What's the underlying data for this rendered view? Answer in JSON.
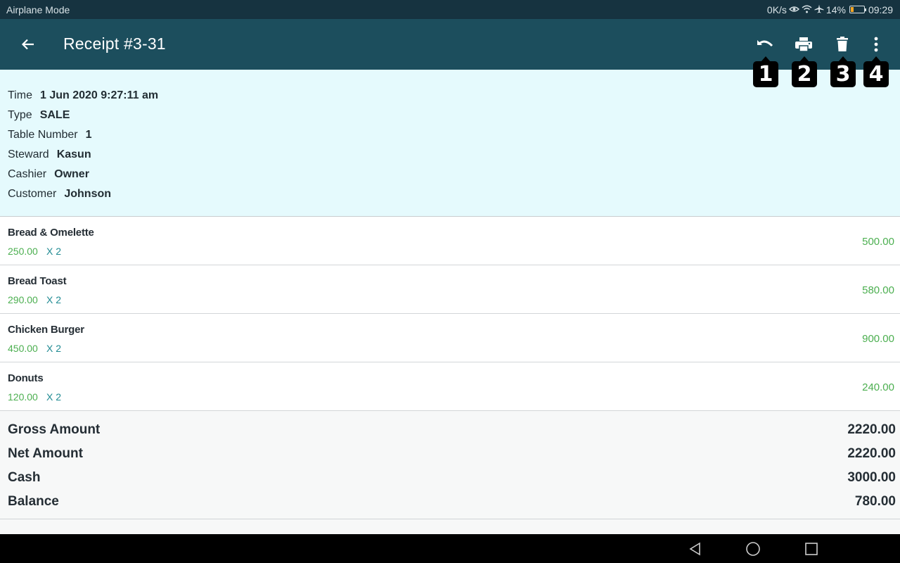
{
  "status_bar": {
    "left_text": "Airplane Mode",
    "net_speed": "0K/s",
    "icons": [
      "eye-comfort-icon",
      "wifi-icon",
      "airplane-icon"
    ],
    "battery_percent": "14%",
    "time": "09:29"
  },
  "app_bar": {
    "title": "Receipt #3-31",
    "back_icon": "arrow-left-icon",
    "actions": [
      {
        "name": "undo",
        "icon": "undo-icon",
        "badge": "1"
      },
      {
        "name": "print",
        "icon": "print-icon",
        "badge": "2"
      },
      {
        "name": "delete",
        "icon": "trash-icon",
        "badge": "3"
      },
      {
        "name": "more",
        "icon": "more-vertical-icon",
        "badge": "4"
      }
    ]
  },
  "info": [
    {
      "label": "Time",
      "value": "1 Jun 2020 9:27:11 am"
    },
    {
      "label": "Type",
      "value": "SALE"
    },
    {
      "label": "Table Number",
      "value": "1"
    },
    {
      "label": "Steward",
      "value": "Kasun"
    },
    {
      "label": "Cashier",
      "value": "Owner"
    },
    {
      "label": "Customer",
      "value": "Johnson"
    }
  ],
  "items": [
    {
      "name": "Bread & Omelette",
      "price": "250.00",
      "qty": "X 2",
      "total": "500.00"
    },
    {
      "name": "Bread Toast",
      "price": "290.00",
      "qty": "X 2",
      "total": "580.00"
    },
    {
      "name": "Chicken Burger",
      "price": "450.00",
      "qty": "X 2",
      "total": "900.00"
    },
    {
      "name": "Donuts",
      "price": "120.00",
      "qty": "X 2",
      "total": "240.00"
    }
  ],
  "summary": [
    {
      "label": "Gross Amount",
      "value": "2220.00"
    },
    {
      "label": "Net Amount",
      "value": "2220.00"
    },
    {
      "label": "Cash",
      "value": "3000.00"
    },
    {
      "label": "Balance",
      "value": "780.00"
    }
  ],
  "colors": {
    "app_bar": "#1c4e5d",
    "status_bar": "#163340",
    "info_bg": "#e5fafd",
    "price_green": "#4caf50",
    "qty_teal": "#1f8a92"
  }
}
